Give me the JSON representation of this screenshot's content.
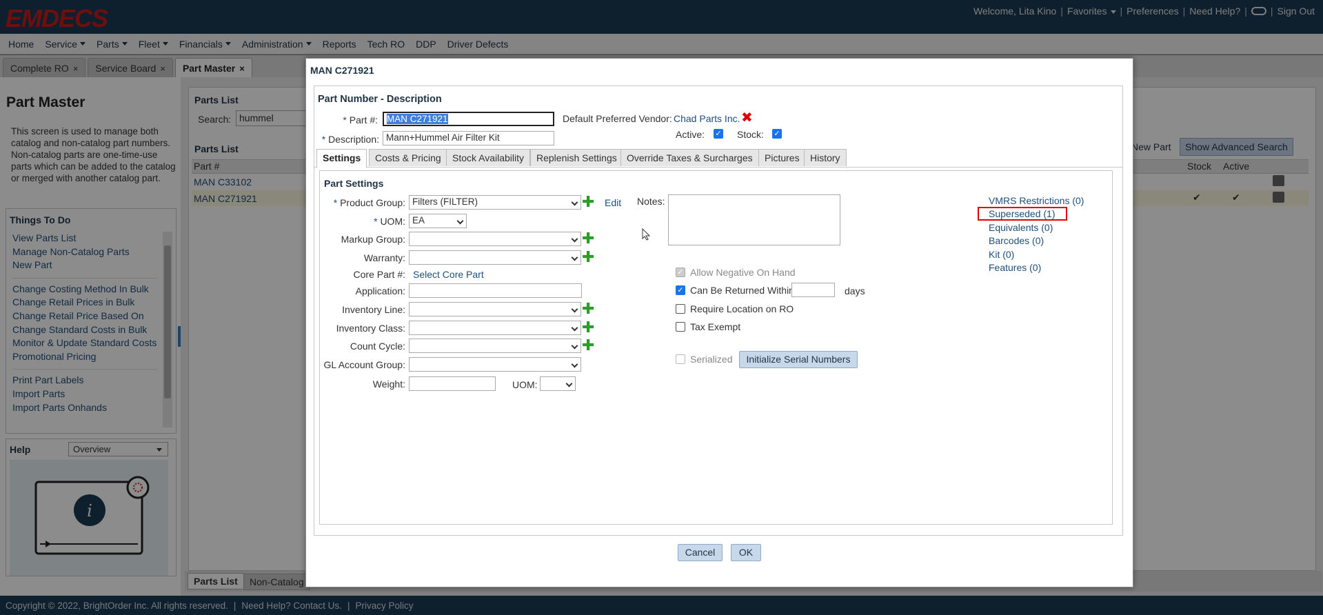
{
  "app": {
    "logo": "EMDECS",
    "welcome": "Welcome, Lita Kino",
    "favorites": "Favorites",
    "preferences": "Preferences",
    "need_help": "Need Help?",
    "sign_out": "Sign Out"
  },
  "menu": [
    "Home",
    "Service",
    "Parts",
    "Fleet",
    "Financials",
    "Administration",
    "Reports",
    "Tech RO",
    "DDP",
    "Driver Defects"
  ],
  "menu_dropdown": [
    false,
    true,
    true,
    true,
    true,
    true,
    false,
    false,
    false,
    false
  ],
  "tabs": [
    {
      "label": "Complete RO",
      "active": false
    },
    {
      "label": "Service Board",
      "active": false
    },
    {
      "label": "Part Master",
      "active": true
    }
  ],
  "left": {
    "title": "Part Master",
    "description": "This screen is used to manage both catalog and non-catalog part numbers. Non-catalog parts are one-time-use parts which can be added to the catalog or merged with another catalog part.",
    "todo_title": "Things To Do",
    "todo_group1": [
      "View Parts List",
      "Manage Non-Catalog Parts",
      "New Part"
    ],
    "todo_group2": [
      "Change Costing Method In Bulk",
      "Change Retail Prices in Bulk",
      "Change Retail Price Based On",
      "Change Standard Costs in Bulk",
      "Monitor & Update Standard Costs",
      "Promotional Pricing"
    ],
    "todo_group3": [
      "Print Part Labels",
      "Import Parts",
      "Import Parts Onhands"
    ],
    "help_title": "Help",
    "help_select": "Overview"
  },
  "main": {
    "parts_list_title": "Parts List",
    "search_label": "Search:",
    "search_value": "hummel",
    "list_title": "Parts List",
    "col_part": "Part #",
    "col_stock": "Stock",
    "col_active": "Active",
    "new_part": "New Part",
    "advanced_search": "Show Advanced Search",
    "rows": [
      {
        "part": "MAN C33102",
        "stock": "",
        "active": ""
      },
      {
        "part": "MAN C271921",
        "stock": "✔",
        "active": "✔"
      }
    ],
    "bottom_tabs": [
      "Parts List",
      "Non-Catalog"
    ]
  },
  "footer": {
    "copyright": "Copyright © 2022, BrightOrder Inc. All rights reserved.",
    "contact": "Need Help? Contact Us.",
    "privacy": "Privacy Policy"
  },
  "modal": {
    "title": "MAN C271921",
    "section": "Part Number - Description",
    "part_label": "Part #:",
    "part_value": "MAN C271921",
    "desc_label": "Description:",
    "desc_value": "Mann+Hummel Air Filter Kit",
    "vendor_label": "Default Preferred Vendor:",
    "vendor_value": "Chad Parts Inc.",
    "active_label": "Active:",
    "stock_label": "Stock:",
    "tabs": [
      "Settings",
      "Costs & Pricing",
      "Stock Availability",
      "Replenish Settings",
      "Override Taxes & Surcharges",
      "Pictures",
      "History"
    ],
    "settings": {
      "title": "Part Settings",
      "product_group_label": "Product Group:",
      "product_group_value": "Filters (FILTER)",
      "edit": "Edit",
      "uom_label": "UOM:",
      "uom_value": "EA",
      "markup_label": "Markup Group:",
      "warranty_label": "Warranty:",
      "core_label": "Core Part #:",
      "core_link": "Select Core Part",
      "application_label": "Application:",
      "inv_line_label": "Inventory Line:",
      "inv_class_label": "Inventory Class:",
      "count_cycle_label": "Count Cycle:",
      "gl_label": "GL Account Group:",
      "weight_label": "Weight:",
      "weight_uom_label": "UOM:",
      "notes_label": "Notes:",
      "allow_negative": "Allow Negative On Hand",
      "can_return": "Can Be Returned Within",
      "days": "days",
      "require_location": "Require Location on RO",
      "tax_exempt": "Tax Exempt",
      "serialized": "Serialized",
      "init_serial": "Initialize Serial Numbers",
      "links": [
        "VMRS Restrictions (0)",
        "Superseded (1)",
        "Equivalents (0)",
        "Barcodes (0)",
        "Kit (0)",
        "Features (0)"
      ]
    },
    "cancel": "Cancel",
    "ok": "OK"
  },
  "colors": {
    "topbar": "#1b3a55",
    "logo": "#c61d1d",
    "highlight": "#e00000",
    "link": "#1f4e79"
  }
}
